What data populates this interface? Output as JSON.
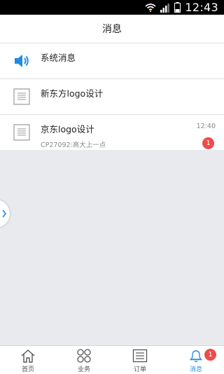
{
  "status": {
    "time": "12:43"
  },
  "header": {
    "title": "消息"
  },
  "messages": [
    {
      "title": "系统消息",
      "icon": "speaker-icon"
    },
    {
      "title": "新东方logo设计",
      "icon": "document-icon"
    },
    {
      "title": "京东logo设计",
      "subtitle": "CP27092:高大上一点",
      "time": "12:40",
      "badge": "1",
      "icon": "document-icon"
    }
  ],
  "tabs": [
    {
      "label": "首页",
      "icon": "home-icon"
    },
    {
      "label": "业务",
      "icon": "grid-circles-icon"
    },
    {
      "label": "订单",
      "icon": "order-list-icon"
    },
    {
      "label": "消息",
      "icon": "bell-icon",
      "badge": "1",
      "active": true
    }
  ],
  "colors": {
    "accent": "#2a8fe6",
    "badge": "#f04a4a",
    "background": "#e9eaee"
  }
}
